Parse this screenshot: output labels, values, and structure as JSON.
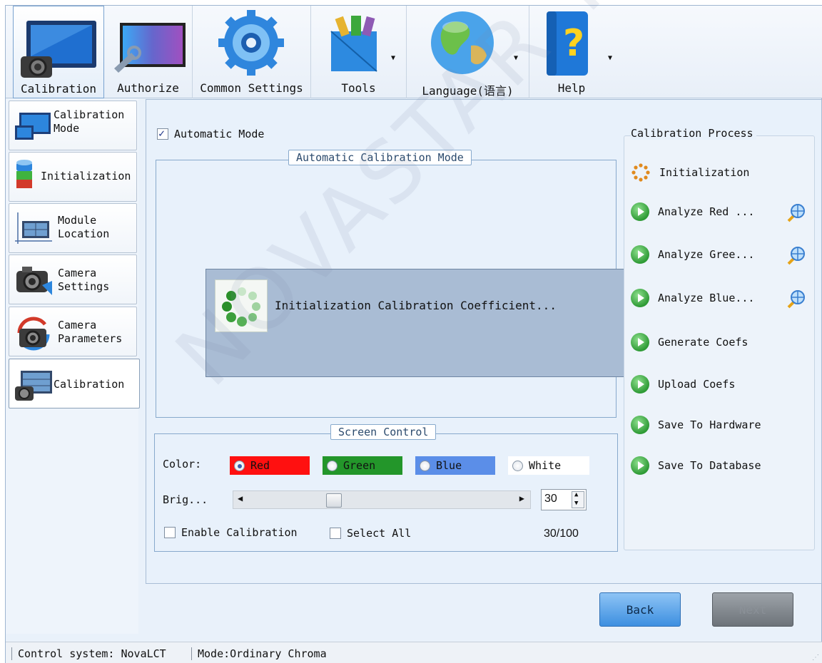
{
  "toolbar": {
    "items": [
      {
        "label": "Calibration",
        "icon": "monitor-camera-icon"
      },
      {
        "label": "Authorize",
        "icon": "led-screen-wrench-icon"
      },
      {
        "label": "Common Settings",
        "icon": "gear-icon"
      },
      {
        "label": "Tools",
        "icon": "toolbox-icon"
      },
      {
        "label": "Language(语言)",
        "icon": "globe-icon"
      },
      {
        "label": "Help",
        "icon": "help-book-icon"
      }
    ]
  },
  "nav": {
    "items": [
      {
        "label": "Calibration\nMode"
      },
      {
        "label": "Initialization"
      },
      {
        "label": "Module\nLocation"
      },
      {
        "label": "Camera\nSettings"
      },
      {
        "label": "Camera\nParameters"
      },
      {
        "label": "Calibration"
      }
    ]
  },
  "main": {
    "auto_mode_label": "Automatic Mode",
    "auto_calib_title": "Automatic Calibration Mode",
    "progress_text": "Initialization Calibration Coefficient...",
    "screen_control": {
      "title": "Screen Control",
      "color_label": "Color:",
      "colors": [
        {
          "label": "Red",
          "bg": "#ff1010"
        },
        {
          "label": "Green",
          "bg": "#23962a"
        },
        {
          "label": "Blue",
          "bg": "#5b8ee8"
        },
        {
          "label": "White",
          "bg": "#ffffff"
        }
      ],
      "brightness_label": "Brig...",
      "brightness_value": "30",
      "enable_calibration": "Enable Calibration",
      "select_all": "Select All",
      "ratio": "30/100"
    }
  },
  "process": {
    "title": "Calibration Process",
    "steps": [
      {
        "label": "Initialization"
      },
      {
        "label": "Analyze Red ..."
      },
      {
        "label": "Analyze Gree..."
      },
      {
        "label": "Analyze Blue..."
      },
      {
        "label": "Generate Coefs"
      },
      {
        "label": "Upload Coefs"
      },
      {
        "label": "Save To Hardware"
      },
      {
        "label": "Save To Database"
      }
    ]
  },
  "buttons": {
    "back": "Back",
    "next": "Next"
  },
  "status": {
    "system": "Control system: NovaLCT",
    "mode": "Mode:Ordinary Chroma"
  },
  "watermark": "NOVASTAR TECH CO.,LTD"
}
